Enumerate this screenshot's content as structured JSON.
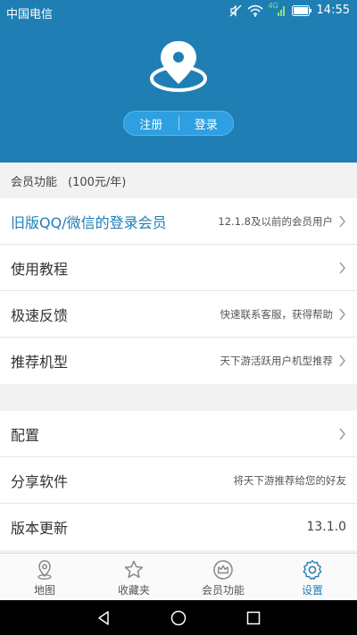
{
  "status_bar": {
    "carrier": "中国电信",
    "time": "14:55",
    "network": "4G"
  },
  "header": {
    "register_label": "注册",
    "login_label": "登录",
    "accent_color": "#1f7fb4"
  },
  "member_section": {
    "title": "会员功能",
    "subtitle": "(100元/年)"
  },
  "list1": [
    {
      "label": "旧版QQ/微信的登录会员",
      "desc": "12.1.8及以前的会员用户",
      "chevron": true
    },
    {
      "label": "使用教程",
      "desc": "",
      "chevron": true
    },
    {
      "label": "极速反馈",
      "desc": "快速联系客服，获得帮助",
      "chevron": true
    },
    {
      "label": "推荐机型",
      "desc": "天下游活跃用户机型推荐",
      "chevron": true
    }
  ],
  "list2": [
    {
      "label": "配置",
      "desc": "",
      "chevron": true
    },
    {
      "label": "分享软件",
      "desc": "将天下游推荐给您的好友",
      "chevron": false
    },
    {
      "label": "版本更新",
      "desc": "13.1.0",
      "chevron": false
    }
  ],
  "tabs": [
    {
      "label": "地图",
      "icon": "map-pin-icon"
    },
    {
      "label": "收藏夹",
      "icon": "star-icon"
    },
    {
      "label": "会员功能",
      "icon": "crown-icon"
    },
    {
      "label": "设置",
      "icon": "gear-icon",
      "active": true
    }
  ]
}
